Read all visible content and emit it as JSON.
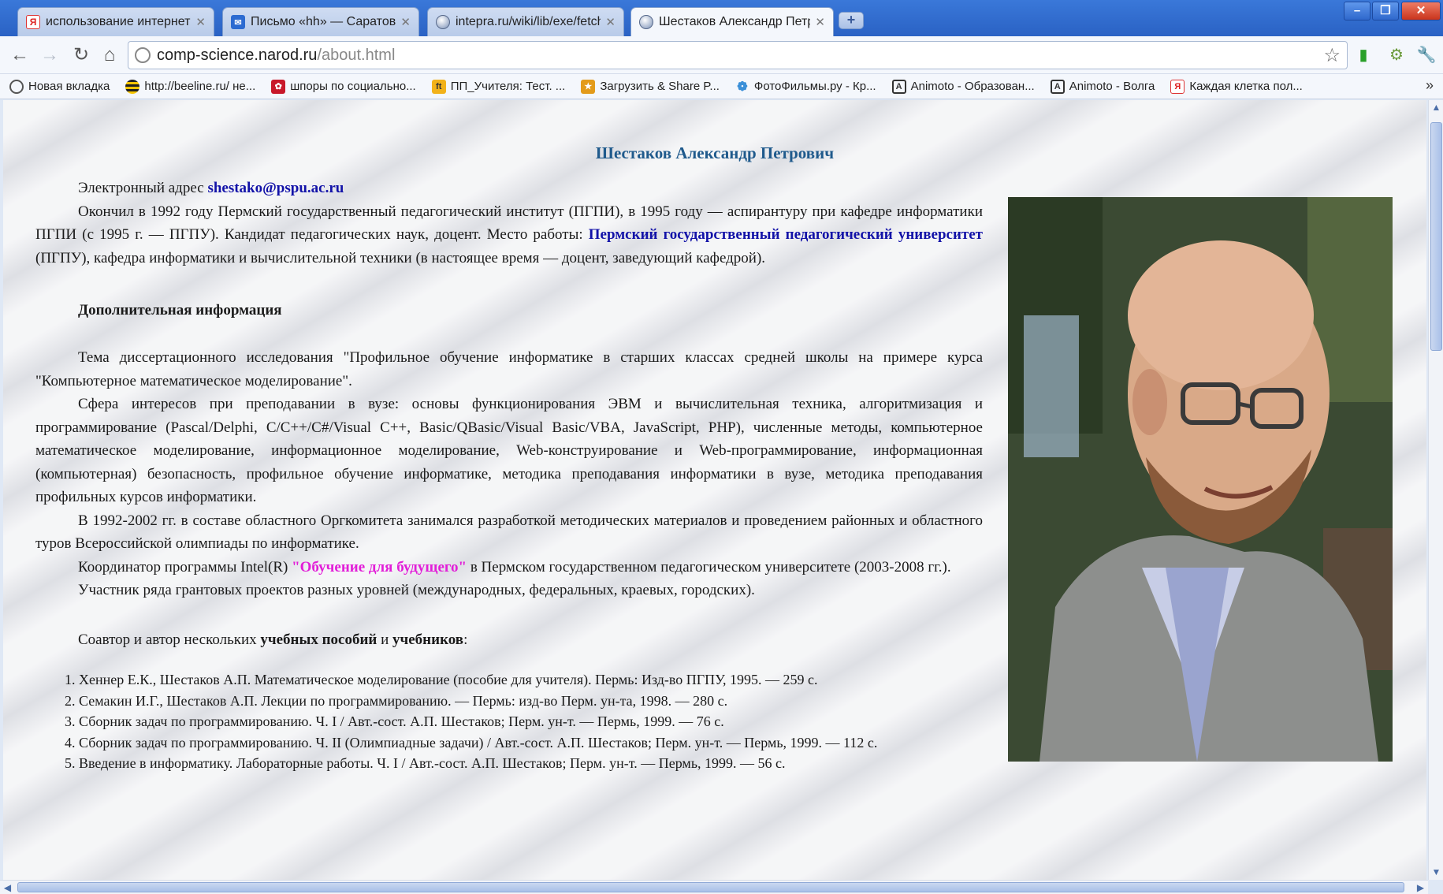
{
  "tabs": [
    {
      "title": "использование интернет ре",
      "favicon": "yandex-icon"
    },
    {
      "title": "Письмо «hh» — Саратов шко",
      "favicon": "mail-icon"
    },
    {
      "title": "intepra.ru/wiki/lib/exe/fetch.p",
      "favicon": "globe-icon"
    },
    {
      "title": "Шестаков Александр Петро",
      "favicon": "globe-icon",
      "active": true
    }
  ],
  "address": {
    "host": "comp-science.narod.ru",
    "path": "/about.html"
  },
  "bookmarks": [
    {
      "label": "Новая вкладка",
      "icon": "globe-icon"
    },
    {
      "label": "http://beeline.ru/ не...",
      "icon": "beeline-icon"
    },
    {
      "label": "шпоры по социально...",
      "icon": "red-icon"
    },
    {
      "label": "ПП_Учителя: Тест. ...",
      "icon": "wiki-icon"
    },
    {
      "label": "Загрузить & Share P...",
      "icon": "share-icon"
    },
    {
      "label": "ФотоФильмы.ру - Кр...",
      "icon": "flower-icon"
    },
    {
      "label": "Animoto - Образован...",
      "icon": "animoto-icon"
    },
    {
      "label": "Animoto - Волга",
      "icon": "animoto-icon"
    },
    {
      "label": "Каждая клетка пол...",
      "icon": "yandex-icon"
    }
  ],
  "content": {
    "title": "Шестаков Александр Петрович",
    "email_label": "Электронный адрес",
    "email": "shestako@pspu.ac.ru",
    "bio_part1": "Окончил в 1992 году Пермский государственный педагогический институт (ПГПИ), в 1995 году — аспирантуру при кафедре информатики ПГПИ (с 1995 г. — ПГПУ). Кандидат педагогических наук, доцент. Место работы:",
    "university_link": "Пермский государственный педагогический университет",
    "bio_part2": "(ПГПУ), кафедра информатики и вычислительной техники (в настоящее время — доцент, заведующий кафедрой).",
    "extra_heading": "Дополнительная информация",
    "dissertation": "Тема диссертационного исследования \"Профильное обучение информатике в старших классах средней школы на примере курса \"Компьютерное математическое моделирование\".",
    "interests": "Сфера интересов при преподавании в вузе: основы функционирования ЭВМ и вычислительная техника, алгоритмизация и программирование (Pascal/Delphi, C/C++/C#/Visual C++, Basic/QBasic/Visual Basic/VBA, JavaScript, PHP), численные методы, компьютерное математическое моделирование, информационное моделирование, Web-конструирование и Web-программирование, информационная (компьютерная) безопасность, профильное обучение информатике, методика преподавания информатики в вузе, методика преподавания профильных курсов информатики.",
    "olympiad": "В 1992-2002 гг. в составе областного Оргкомитета занимался разработкой методических материалов и проведением районных и областного туров Всероссийской олимпиады по информатике.",
    "intel_part1": "Координатор программы Intel(R)",
    "intel_link": "\"Обучение для будущего\"",
    "intel_part2": "в Пермском государственном педагогическом университете (2003-2008 гг.).",
    "grants": "Участник ряда грантовых проектов разных уровней (международных, федеральных, краевых, городских).",
    "coauthor_part1": "Соавтор и автор нескольких",
    "coauthor_bold1": "учебных пособий",
    "coauthor_and": "и",
    "coauthor_bold2": "учебников",
    "coauthor_colon": ":",
    "books": [
      "Хеннер Е.К., Шестаков А.П. Математическое моделирование (пособие для учителя). Пермь: Изд-во ПГПУ, 1995. — 259 с.",
      "Семакин И.Г., Шестаков А.П. Лекции по программированию. — Пермь: изд-во Перм. ун-та, 1998. — 280 с.",
      "Сборник задач по программированию. Ч. I / Авт.-сост. А.П. Шестаков; Перм. ун-т. — Пермь, 1999. — 76 с.",
      "Сборник задач по программированию. Ч. II (Олимпиадные задачи) / Авт.-сост. А.П. Шестаков; Перм. ун-т. — Пермь, 1999. — 112 с.",
      "Введение в информатику. Лабораторные работы. Ч. I / Авт.-сост. А.П. Шестаков; Перм. ун-т. — Пермь, 1999. — 56 с."
    ]
  },
  "colors": {
    "title": "#1f5a8c",
    "link": "#1212a8",
    "highlight_link": "#e21ed8",
    "chrome": "#2a62c4"
  }
}
